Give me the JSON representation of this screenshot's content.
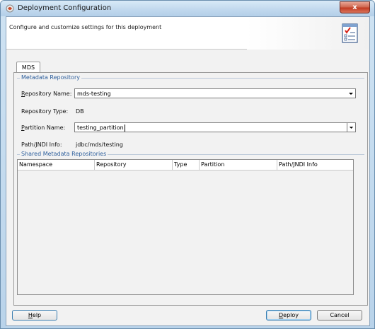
{
  "window": {
    "title": "Deployment Configuration",
    "close_glyph": "x"
  },
  "header": {
    "description": "Configure and customize settings for this deployment",
    "icon": "checklist-icon"
  },
  "tabs": [
    {
      "label": "MDS",
      "selected": true
    }
  ],
  "metadata_repository": {
    "group_title": "Metadata Repository",
    "repository_name_label": "Repository Name:",
    "repository_name_value": "mds-testing",
    "repository_type_label": "Repository Type:",
    "repository_type_value": "DB",
    "partition_name_label": "Partition Name:",
    "partition_name_value": "testing_partition",
    "jndi_label": "Path/JNDI Info:",
    "jndi_value": "jdbc/mds/testing"
  },
  "shared_repositories": {
    "group_title": "Shared Metadata Repositories",
    "columns": [
      "Namespace",
      "Repository",
      "Type",
      "Partition",
      "Path/JNDI Info"
    ],
    "rows": []
  },
  "buttons": {
    "help": "Help",
    "deploy": "Deploy",
    "cancel": "Cancel"
  },
  "colors": {
    "group_title": "#2c5e9c",
    "title_bar": "#c2d9ee",
    "close_button": "#c23c22"
  }
}
